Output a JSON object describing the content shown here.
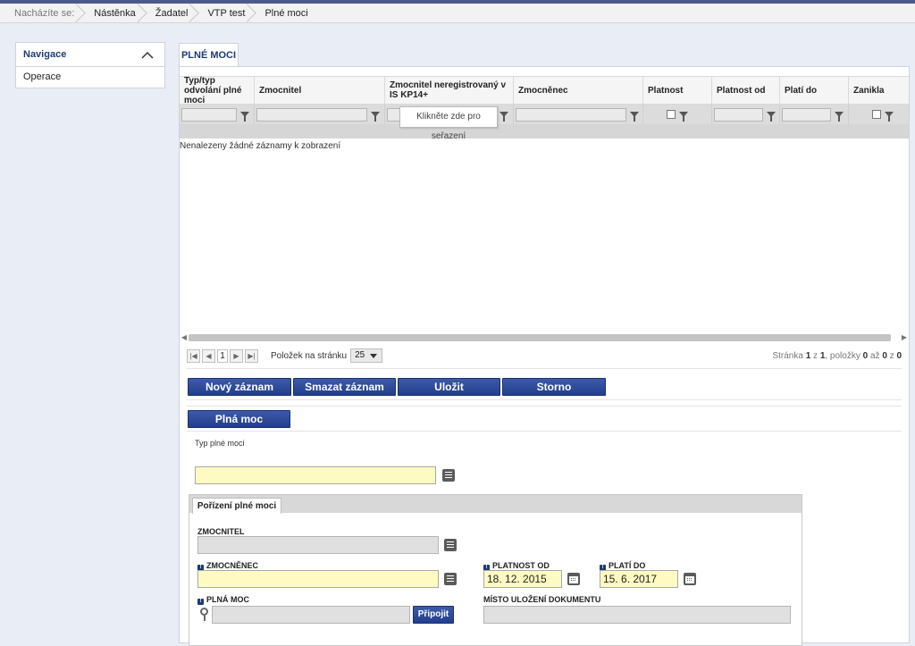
{
  "breadcrumb": {
    "prefix": "Nacházíte se:",
    "items": [
      "Nástěnka",
      "Žadatel",
      "VTP test",
      "Plné moci"
    ]
  },
  "navigation": {
    "title": "Navigace",
    "items": [
      "Operace"
    ]
  },
  "main_tab": "PLNÉ MOCI",
  "grid": {
    "columns": [
      "Typ/typ odvolání plné moci",
      "Zmocnitel",
      "Zmocnitel neregistrovaný v IS KP14+",
      "Zmocněnec",
      "Platnost",
      "Platnost od",
      "Platí do",
      "Zanikla"
    ],
    "empty_message": "Nenalezeny žádné záznamy k zobrazení",
    "tooltip": "Klikněte zde pro seřazení"
  },
  "pager": {
    "current_page": "1",
    "page_size_label": "Položek na stránku",
    "page_size": "25",
    "info_prefix": "Stránka",
    "info_page": "1",
    "info_of": "z",
    "info_total_pages": "1",
    "info_items": ", položky",
    "info_from": "0",
    "info_to_word": "až",
    "info_to": "0",
    "info_z": "z",
    "info_count": "0"
  },
  "actions": {
    "new": "Nový záznam",
    "delete": "Smazat záznam",
    "save": "Uložit",
    "cancel": "Storno"
  },
  "section_button": "Plná moc",
  "form": {
    "type_label": "Typ plné moci",
    "type_value": "",
    "subtab": "Pořízení plné moci",
    "zmocnitel_label": "ZMOCNITEL",
    "zmocnitel_value": "",
    "zmocnenec_label": "ZMOCNĚNEC",
    "zmocnenec_value": "",
    "platnost_od_label": "PLATNOST OD",
    "platnost_od_value": "18. 12. 2015",
    "plati_do_label": "PLATÍ DO",
    "plati_do_value": "15. 6. 2017",
    "plna_moc_label": "PLNÁ MOC",
    "attach_button": "Připojit",
    "misto_label": "MÍSTO ULOŽENÍ DOKUMENTU",
    "misto_value": "",
    "required_mark": "!"
  },
  "colors": {
    "accent": "#1f3a78",
    "button": "#2a4896",
    "required_field": "#fdfbc1",
    "page_bg": "#e9edf6"
  }
}
